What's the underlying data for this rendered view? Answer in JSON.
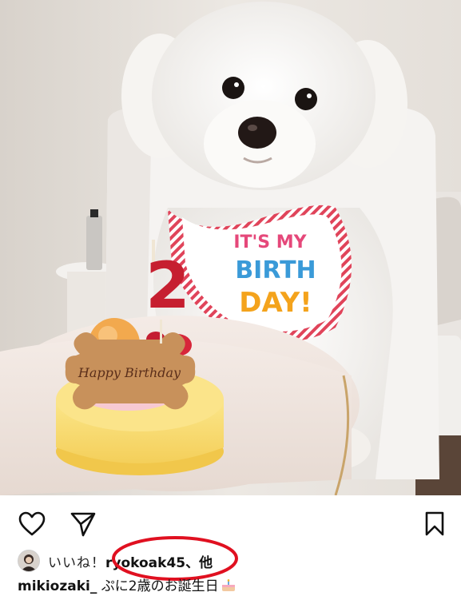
{
  "post": {
    "likes": {
      "prefix": "いいね！",
      "first_liker": "ryokoak45",
      "others_suffix": "、他"
    },
    "caption": {
      "author": "mikiozaki_",
      "text": " ぷに2歳のお誕生日"
    }
  },
  "photo": {
    "cookie_text": "Happy Birthday",
    "bib_text_line1": "IT'S MY",
    "bib_text_line2": "BIRTH",
    "bib_text_line3": "DAY!",
    "candle_number": "2"
  },
  "icons": {
    "like": "heart-outline-icon",
    "share": "paper-plane-icon",
    "save": "bookmark-outline-icon",
    "caption_emoji": "birthday-cake-emoji"
  },
  "colors": {
    "highlight_ring": "#e01020",
    "text": "#111111"
  }
}
